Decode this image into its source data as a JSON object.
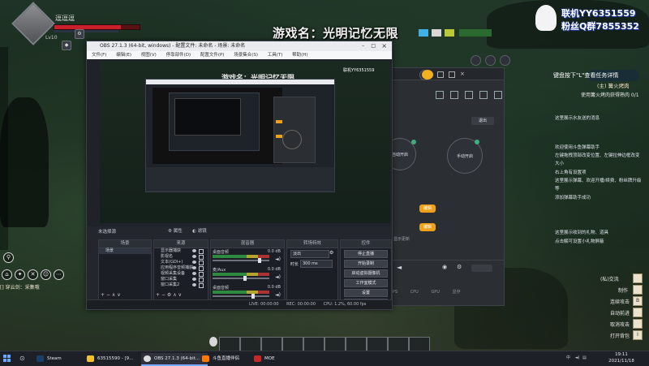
{
  "game": {
    "title": "游戏名：光明记忆无限",
    "player_name": "逗逗逗",
    "level": "Lv10",
    "hp_fraction": 0.78,
    "chat_line": "[] 穿云剑：采集哦",
    "accent": "#c8212b"
  },
  "promo": {
    "line1": "联机YY6351559",
    "line2": "粉丝Q群7855352"
  },
  "obs": {
    "title": "OBS 27.1.3 (64-bit, windows) - 配置文件: 未命名 - 场景: 未命名",
    "menu": [
      "文件(F)",
      "编辑(E)",
      "视图(V)",
      "停靠部件(D)",
      "配置文件(P)",
      "场景集合(S)",
      "工具(T)",
      "帮助(H)"
    ],
    "no_source_selected": "未选择源",
    "properties_btn": "属性",
    "filters_btn": "滤镜",
    "dock_headers": {
      "scenes": "场景",
      "sources": "来源",
      "mixer": "混音器",
      "transitions": "转场特效",
      "controls": "控件"
    },
    "scenes": [
      "场景"
    ],
    "sources": [
      "显示器捕获",
      "影视名",
      "文本(GDI+)",
      "应用程序音频捕获",
      "视频采集设备",
      "窗口采集",
      "窗口采集2"
    ],
    "mixer": [
      {
        "name": "桌面音频",
        "level": "0.0 dB"
      },
      {
        "name": "麦/Aux",
        "level": "0.0 dB"
      },
      {
        "name": "桌面音频",
        "level": "0.0 dB"
      }
    ],
    "transition_type": "淡出",
    "duration_label": "时长",
    "duration_value": "300 ms",
    "controls": [
      "停止直播",
      "开始录制",
      "启动虚拟摄像机",
      "工作室模式",
      "设置",
      "退出"
    ],
    "status": {
      "live": "LIVE: 00:00:00",
      "rec": "REC: 00:00:00",
      "cpu": "CPU: 1.2%, 60.00 fps"
    }
  },
  "nested_preview": {
    "title": "游戏名：光明记忆无限",
    "promo": "联机YY6351559"
  },
  "huya": {
    "buttons": [
      "退出"
    ],
    "circle_left": "自动开启",
    "circle_right": "手动开启",
    "orange_buttons": [
      "编辑",
      "编辑"
    ],
    "section_text": "显示更新",
    "bottom_labels": [
      "FPS",
      "CPU",
      "GPU",
      "显存"
    ]
  },
  "right_panel": {
    "hint_title": "键盘按下\"L\"查看任务详情",
    "subtitle": "(主) 篝火烤肉",
    "subtitle2": "使用篝火烤肉获得熟肉 0/1",
    "lines": [
      "这里展示水友送的消息",
      "欢迎使用斗鱼弹幕助手",
      "左键拖拽顶部改变位置、左键拉伸边框改变",
      "大小",
      "右上角有设置项",
      "这里展示弹幕、欢迎开播/续费、粉丝牌升级",
      "等",
      "添加弹幕助手成功",
      "这里展示收到的礼物、道具",
      "点击解可设置小礼物屏蔽"
    ],
    "shortcuts": [
      {
        "label": "(私)交流",
        "key": ""
      },
      {
        "label": "制作",
        "key": ""
      },
      {
        "label": "连续攻击",
        "key": "B"
      },
      {
        "label": "自动前进",
        "key": ""
      },
      {
        "label": "取消攻击",
        "key": ""
      },
      {
        "label": "打开背包",
        "key": "I"
      }
    ]
  },
  "taskbar": {
    "apps": [
      "Steam",
      "63515590 - [9...",
      "OBS 27.1.3 (64-bit...",
      "斗鱼直播伴侣",
      "MOE"
    ],
    "time": "19:11",
    "date": "2021/11/18",
    "tray": "中"
  }
}
